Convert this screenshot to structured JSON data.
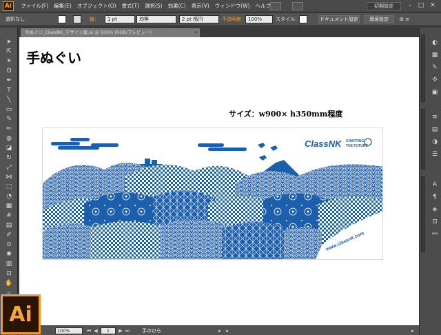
{
  "app": {
    "logo_text": "Ai",
    "menus": [
      "ファイル(F)",
      "編集(E)",
      "オブジェクト(O)",
      "書式(T)",
      "選択(S)",
      "効果(C)",
      "表示(V)",
      "ウィンドウ(W)",
      "ヘルプ(H)"
    ],
    "workspace": "初期設定",
    "accent": "#f09a2a"
  },
  "control_bar": {
    "selection": "選択なし",
    "stroke_label": "線：",
    "stroke_weight": "1 pt",
    "stroke_style": "均等",
    "brush": "2 pt 楕円",
    "opacity_label": "不透明度：",
    "opacity_value": "100%",
    "style_label": "スタイル：",
    "doc_settings": "ドキュメント設定",
    "prefs": "環境設定"
  },
  "document_tab": {
    "title": "手ぬぐい_ClassNK_デザイン案.ai @ 100% (RGB/プレビュー)"
  },
  "artboard": {
    "title": "手ぬぐい",
    "size_label": "サイズ：w900× h350mm程度",
    "brand": "ClassNK",
    "tagline_1": "CHARTING",
    "tagline_2": "THE FUTURE",
    "url": "www.classnk.com",
    "pattern_color": "#1c5fad"
  },
  "status_bar": {
    "zoom": "100%",
    "page": "1",
    "status": "手のひら"
  },
  "big_logo": "Ai"
}
